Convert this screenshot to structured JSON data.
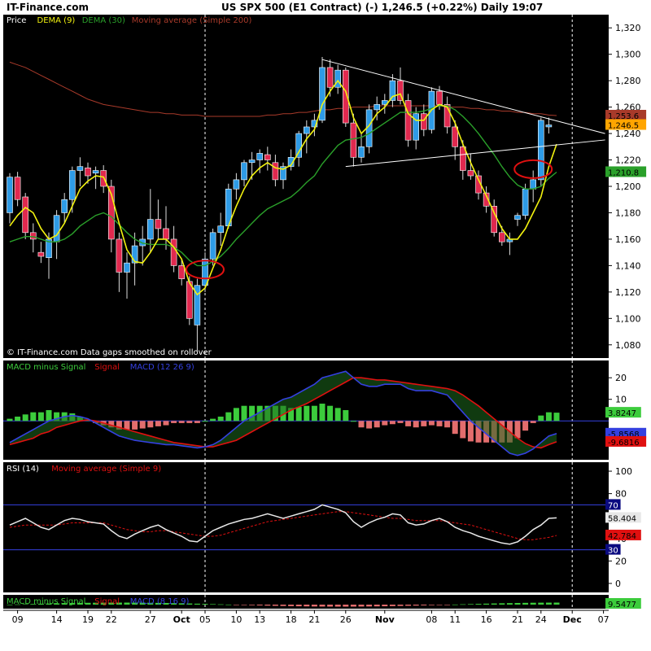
{
  "header": {
    "brand": "IT-Finance.com",
    "title": "US SPX 500 (E1 Contract) (-)    1,246.5 (+0.22%)    Daily  19:07"
  },
  "colors": {
    "background": "#000000",
    "up_candle": "#2e9be6",
    "down_candle": "#e0294f",
    "dema9": "#f2f20f",
    "dema30": "#2aa02a",
    "sma200": "#a83a2a",
    "trendline": "#ffffff",
    "macd": "#3440e0",
    "signal": "#e01010",
    "hist_pos": "#3ccc3c",
    "hist_neg": "#e36d6d",
    "rsi": "#e8e8e8",
    "rsi_ma": "#e01010",
    "ref_line": "#3440e0",
    "circle": "#e01010"
  },
  "chart_data": [
    {
      "type": "candlestick",
      "panel": "price",
      "legend": [
        "Price",
        "DEMA (9)",
        "DEMA (30)",
        "Moving average (Simple 200)"
      ],
      "footnote": "© IT-Finance.com  Data gaps smoothed on rollover",
      "y_ticks": [
        1080,
        1100,
        1120,
        1140,
        1160,
        1180,
        1200,
        1220,
        1240,
        1260,
        1280,
        1300,
        1320
      ],
      "ylim": [
        1070,
        1330
      ],
      "last_price_label": "1,246.5",
      "labels_right": [
        {
          "text": "1,253.6",
          "value": 1253.6,
          "bg": "#a83a2a"
        },
        {
          "text": "1,246.5",
          "value": 1246.5,
          "bg": "#ffa500"
        },
        {
          "text": "1,210.8",
          "value": 1210.8,
          "bg": "#2aa02a"
        }
      ],
      "candles": [
        {
          "o": 1180,
          "h": 1210,
          "l": 1172,
          "c": 1207
        },
        {
          "o": 1207,
          "h": 1211,
          "l": 1185,
          "c": 1190
        },
        {
          "o": 1192,
          "h": 1195,
          "l": 1160,
          "c": 1165
        },
        {
          "o": 1165,
          "h": 1172,
          "l": 1150,
          "c": 1160
        },
        {
          "o": 1150,
          "h": 1158,
          "l": 1142,
          "c": 1147
        },
        {
          "o": 1146,
          "h": 1165,
          "l": 1130,
          "c": 1160
        },
        {
          "o": 1158,
          "h": 1182,
          "l": 1145,
          "c": 1178
        },
        {
          "o": 1180,
          "h": 1195,
          "l": 1172,
          "c": 1190
        },
        {
          "o": 1190,
          "h": 1215,
          "l": 1180,
          "c": 1212
        },
        {
          "o": 1212,
          "h": 1222,
          "l": 1200,
          "c": 1215
        },
        {
          "o": 1214,
          "h": 1218,
          "l": 1202,
          "c": 1208
        },
        {
          "o": 1210,
          "h": 1215,
          "l": 1198,
          "c": 1212
        },
        {
          "o": 1212,
          "h": 1216,
          "l": 1195,
          "c": 1200
        },
        {
          "o": 1200,
          "h": 1205,
          "l": 1150,
          "c": 1160
        },
        {
          "o": 1160,
          "h": 1165,
          "l": 1120,
          "c": 1135
        },
        {
          "o": 1135,
          "h": 1150,
          "l": 1115,
          "c": 1142
        },
        {
          "o": 1142,
          "h": 1165,
          "l": 1125,
          "c": 1155
        },
        {
          "o": 1155,
          "h": 1170,
          "l": 1140,
          "c": 1160
        },
        {
          "o": 1160,
          "h": 1198,
          "l": 1150,
          "c": 1175
        },
        {
          "o": 1175,
          "h": 1190,
          "l": 1160,
          "c": 1168
        },
        {
          "o": 1168,
          "h": 1185,
          "l": 1152,
          "c": 1160
        },
        {
          "o": 1160,
          "h": 1170,
          "l": 1135,
          "c": 1140
        },
        {
          "o": 1140,
          "h": 1145,
          "l": 1125,
          "c": 1130
        },
        {
          "o": 1128,
          "h": 1132,
          "l": 1095,
          "c": 1100
        },
        {
          "o": 1095,
          "h": 1130,
          "l": 1075,
          "c": 1125
        },
        {
          "o": 1125,
          "h": 1150,
          "l": 1120,
          "c": 1145
        },
        {
          "o": 1145,
          "h": 1168,
          "l": 1140,
          "c": 1165
        },
        {
          "o": 1165,
          "h": 1180,
          "l": 1155,
          "c": 1170
        },
        {
          "o": 1170,
          "h": 1202,
          "l": 1168,
          "c": 1198
        },
        {
          "o": 1198,
          "h": 1210,
          "l": 1190,
          "c": 1205
        },
        {
          "o": 1205,
          "h": 1220,
          "l": 1200,
          "c": 1218
        },
        {
          "o": 1218,
          "h": 1226,
          "l": 1205,
          "c": 1220
        },
        {
          "o": 1220,
          "h": 1228,
          "l": 1210,
          "c": 1225
        },
        {
          "o": 1224,
          "h": 1230,
          "l": 1212,
          "c": 1220
        },
        {
          "o": 1218,
          "h": 1224,
          "l": 1200,
          "c": 1205
        },
        {
          "o": 1205,
          "h": 1218,
          "l": 1198,
          "c": 1215
        },
        {
          "o": 1215,
          "h": 1228,
          "l": 1212,
          "c": 1222
        },
        {
          "o": 1222,
          "h": 1242,
          "l": 1215,
          "c": 1240
        },
        {
          "o": 1240,
          "h": 1250,
          "l": 1225,
          "c": 1245
        },
        {
          "o": 1245,
          "h": 1255,
          "l": 1238,
          "c": 1250
        },
        {
          "o": 1250,
          "h": 1298,
          "l": 1248,
          "c": 1290
        },
        {
          "o": 1290,
          "h": 1296,
          "l": 1268,
          "c": 1275
        },
        {
          "o": 1275,
          "h": 1292,
          "l": 1270,
          "c": 1288
        },
        {
          "o": 1288,
          "h": 1290,
          "l": 1245,
          "c": 1248
        },
        {
          "o": 1248,
          "h": 1255,
          "l": 1215,
          "c": 1222
        },
        {
          "o": 1222,
          "h": 1240,
          "l": 1218,
          "c": 1230
        },
        {
          "o": 1230,
          "h": 1262,
          "l": 1225,
          "c": 1258
        },
        {
          "o": 1258,
          "h": 1268,
          "l": 1250,
          "c": 1262
        },
        {
          "o": 1262,
          "h": 1270,
          "l": 1255,
          "c": 1265
        },
        {
          "o": 1265,
          "h": 1285,
          "l": 1260,
          "c": 1280
        },
        {
          "o": 1280,
          "h": 1290,
          "l": 1262,
          "c": 1265
        },
        {
          "o": 1265,
          "h": 1270,
          "l": 1230,
          "c": 1235
        },
        {
          "o": 1235,
          "h": 1260,
          "l": 1228,
          "c": 1255
        },
        {
          "o": 1255,
          "h": 1262,
          "l": 1238,
          "c": 1243
        },
        {
          "o": 1243,
          "h": 1275,
          "l": 1240,
          "c": 1272
        },
        {
          "o": 1272,
          "h": 1276,
          "l": 1258,
          "c": 1262
        },
        {
          "o": 1262,
          "h": 1268,
          "l": 1240,
          "c": 1245
        },
        {
          "o": 1245,
          "h": 1250,
          "l": 1220,
          "c": 1230
        },
        {
          "o": 1230,
          "h": 1235,
          "l": 1205,
          "c": 1212
        },
        {
          "o": 1212,
          "h": 1225,
          "l": 1205,
          "c": 1208
        },
        {
          "o": 1208,
          "h": 1212,
          "l": 1190,
          "c": 1195
        },
        {
          "o": 1195,
          "h": 1200,
          "l": 1180,
          "c": 1185
        },
        {
          "o": 1185,
          "h": 1190,
          "l": 1162,
          "c": 1165
        },
        {
          "o": 1165,
          "h": 1170,
          "l": 1155,
          "c": 1158
        },
        {
          "o": 1158,
          "h": 1165,
          "l": 1148,
          "c": 1160
        },
        {
          "o": 1175,
          "h": 1180,
          "l": 1170,
          "c": 1178
        },
        {
          "o": 1178,
          "h": 1202,
          "l": 1175,
          "c": 1198
        },
        {
          "o": 1198,
          "h": 1212,
          "l": 1188,
          "c": 1205
        },
        {
          "o": 1205,
          "h": 1252,
          "l": 1200,
          "c": 1250
        },
        {
          "o": 1245,
          "h": 1252,
          "l": 1240,
          "c": 1246.5
        }
      ],
      "dema9": [
        1170,
        1178,
        1184,
        1180,
        1168,
        1160,
        1163,
        1172,
        1185,
        1198,
        1204,
        1208,
        1207,
        1194,
        1172,
        1152,
        1143,
        1142,
        1150,
        1160,
        1160,
        1154,
        1145,
        1127,
        1118,
        1123,
        1138,
        1152,
        1170,
        1185,
        1198,
        1208,
        1214,
        1218,
        1214,
        1213,
        1216,
        1226,
        1236,
        1243,
        1262,
        1272,
        1280,
        1272,
        1252,
        1240,
        1246,
        1255,
        1260,
        1268,
        1270,
        1255,
        1250,
        1250,
        1258,
        1262,
        1260,
        1248,
        1232,
        1218,
        1205,
        1193,
        1180,
        1168,
        1160,
        1160,
        1168,
        1180,
        1192,
        1215,
        1232
      ],
      "dema30": [
        1158,
        1160,
        1162,
        1162,
        1160,
        1158,
        1158,
        1160,
        1164,
        1170,
        1174,
        1178,
        1180,
        1177,
        1171,
        1165,
        1160,
        1157,
        1156,
        1156,
        1156,
        1154,
        1150,
        1144,
        1140,
        1140,
        1143,
        1147,
        1153,
        1160,
        1166,
        1172,
        1178,
        1183,
        1186,
        1189,
        1192,
        1197,
        1203,
        1208,
        1217,
        1224,
        1231,
        1235,
        1236,
        1237,
        1240,
        1244,
        1248,
        1252,
        1256,
        1256,
        1256,
        1257,
        1259,
        1261,
        1261,
        1258,
        1253,
        1247,
        1240,
        1232,
        1224,
        1215,
        1207,
        1201,
        1198,
        1198,
        1200,
        1206,
        1210.8
      ],
      "sma200": [
        1294,
        1292,
        1290,
        1287,
        1284,
        1281,
        1278,
        1275,
        1272,
        1269,
        1266,
        1264,
        1262,
        1261,
        1260,
        1259,
        1258,
        1257,
        1256,
        1256,
        1255,
        1255,
        1254,
        1254,
        1254,
        1253,
        1253,
        1253,
        1253,
        1253,
        1253,
        1253,
        1253,
        1254,
        1254,
        1255,
        1255,
        1256,
        1256,
        1257,
        1258,
        1258,
        1259,
        1259,
        1260,
        1260,
        1260,
        1261,
        1261,
        1261,
        1261,
        1261,
        1261,
        1261,
        1261,
        1261,
        1260,
        1260,
        1260,
        1259,
        1259,
        1258,
        1258,
        1257,
        1257,
        1256,
        1256,
        1255,
        1255,
        1254,
        1253.6
      ],
      "trend_upper": [
        {
          "i": 40,
          "v": 1296
        },
        {
          "i": 71,
          "v": 1248
        }
      ],
      "trend_lower": [
        {
          "i": 43,
          "v": 1215
        },
        {
          "i": 71,
          "v": 1232
        }
      ],
      "circles": [
        {
          "i": 25,
          "v": 1137
        },
        {
          "i": 67,
          "v": 1213
        }
      ]
    },
    {
      "type": "histogram+line",
      "panel": "macd",
      "legend": [
        "MACD minus Signal",
        "Signal",
        "MACD (12 26 9)"
      ],
      "y_ticks": [
        10,
        20
      ],
      "ylim": [
        -18,
        28
      ],
      "labels_right": [
        {
          "text": "3.8247",
          "value": 3.8247,
          "bg": "#3ccc3c"
        },
        {
          "text": "-5.8568",
          "value": -5.8568,
          "bg": "#3440e0"
        },
        {
          "text": "-9.6816",
          "value": -9.6816,
          "bg": "#e01010"
        }
      ],
      "macd": [
        -10,
        -8,
        -6,
        -4,
        -2,
        0,
        1,
        2,
        2.5,
        2,
        1,
        -1,
        -3,
        -5,
        -7,
        -8,
        -9,
        -9.5,
        -10,
        -10.5,
        -11,
        -11,
        -11.5,
        -12,
        -12.5,
        -12,
        -11,
        -9,
        -6,
        -3,
        0,
        2,
        4,
        6,
        8,
        10,
        11,
        13,
        15,
        17,
        20,
        21,
        22,
        23,
        20,
        17,
        16,
        16,
        17,
        17,
        17,
        15,
        14,
        14,
        14,
        13,
        12,
        8,
        4,
        0,
        -3,
        -6,
        -9,
        -12,
        -15,
        -16,
        -15,
        -13,
        -10,
        -7,
        -5.8568
      ],
      "signal": [
        -11,
        -10,
        -9,
        -8,
        -6,
        -5,
        -3,
        -2,
        -1,
        0,
        0.5,
        0,
        -1,
        -2,
        -3,
        -4,
        -5,
        -6,
        -7,
        -8,
        -9,
        -10,
        -10.5,
        -11,
        -11.5,
        -12,
        -12,
        -11,
        -10,
        -9,
        -7,
        -5,
        -3,
        -1,
        1,
        3,
        5,
        6.5,
        8,
        10,
        12,
        14,
        16,
        18,
        20,
        20,
        19.5,
        19,
        19,
        18.5,
        18,
        17.5,
        17,
        16.5,
        16,
        15.5,
        15,
        14,
        12,
        9.5,
        7,
        4,
        1,
        -2,
        -5,
        -8,
        -10.5,
        -12,
        -12.5,
        -11,
        -9.6816
      ],
      "histogram": [
        1,
        2,
        3,
        4,
        4,
        5,
        4,
        4,
        3.5,
        2,
        0.5,
        -1,
        -2,
        -3,
        -4,
        -4,
        -4,
        -3.5,
        -3,
        -2.5,
        -2,
        -1,
        -1,
        -1,
        -1,
        0,
        1,
        2,
        4,
        6,
        7,
        7,
        7,
        7,
        7,
        7,
        6,
        6.5,
        7,
        7,
        8,
        7,
        6,
        5,
        0,
        -3,
        -3.5,
        -3,
        -2,
        -1.5,
        -1,
        -2.5,
        -3,
        -2.5,
        -2,
        -2.5,
        -3,
        -6,
        -8,
        -9.5,
        -10,
        -10,
        -10,
        -10,
        -10,
        -8,
        -4.5,
        -1,
        2.5,
        4,
        3.8247
      ]
    },
    {
      "type": "line",
      "panel": "rsi",
      "legend": [
        "RSI (14)",
        "Moving average (Simple 9)"
      ],
      "y_ticks": [
        0,
        20,
        40,
        60,
        80,
        100
      ],
      "ylim": [
        -8,
        108
      ],
      "ref_lines": [
        {
          "value": 70,
          "label": "70"
        },
        {
          "value": 30,
          "label": "30"
        }
      ],
      "labels_right": [
        {
          "text": "58.404",
          "value": 58.404,
          "bg": "#e8e8e8"
        },
        {
          "text": "42.784",
          "value": 42.784,
          "bg": "#e01010"
        }
      ],
      "rsi": [
        52,
        55,
        58,
        54,
        50,
        48,
        52,
        56,
        58,
        57,
        55,
        54,
        53,
        47,
        42,
        40,
        44,
        47,
        50,
        52,
        48,
        45,
        42,
        38,
        37,
        42,
        47,
        50,
        53,
        55,
        57,
        58,
        60,
        62,
        60,
        58,
        60,
        62,
        64,
        66,
        70,
        68,
        66,
        63,
        55,
        50,
        54,
        57,
        59,
        62,
        61,
        54,
        52,
        53,
        56,
        58,
        55,
        50,
        47,
        45,
        42,
        40,
        38,
        36,
        35,
        37,
        42,
        48,
        52,
        58,
        58.404
      ],
      "rsi_ma": [
        50,
        51,
        52,
        52,
        52,
        52,
        52,
        53,
        54,
        54,
        54,
        54,
        54,
        52,
        50,
        48,
        47,
        46,
        46,
        47,
        47,
        46,
        45,
        44,
        43,
        42,
        42,
        43,
        45,
        47,
        49,
        51,
        53,
        55,
        56,
        57,
        58,
        59,
        60,
        61,
        62,
        63,
        64,
        64,
        63,
        62,
        61,
        60,
        59,
        58,
        58,
        57,
        56,
        56,
        56,
        56,
        55,
        54,
        53,
        52,
        50,
        48,
        46,
        44,
        42,
        40,
        39,
        39,
        40,
        41,
        42.784
      ]
    },
    {
      "type": "histogram+line",
      "panel": "macd2",
      "legend": [
        "MACD minus Signal",
        "Signal",
        "MACD (8 16 9)"
      ],
      "labels_right": [
        {
          "text": "9.5477",
          "value": 9.5477,
          "bg": "#3ccc3c"
        }
      ]
    }
  ],
  "x_axis": {
    "ticks": [
      {
        "i": 1,
        "label": "09"
      },
      {
        "i": 6,
        "label": "14"
      },
      {
        "i": 10,
        "label": "19"
      },
      {
        "i": 13,
        "label": "22"
      },
      {
        "i": 18,
        "label": "27"
      },
      {
        "i": 22,
        "label": "Oct"
      },
      {
        "i": 25,
        "label": "05"
      },
      {
        "i": 29,
        "label": "10"
      },
      {
        "i": 32,
        "label": "13"
      },
      {
        "i": 36,
        "label": "18"
      },
      {
        "i": 39,
        "label": "21"
      },
      {
        "i": 43,
        "label": "26"
      },
      {
        "i": 48,
        "label": "Nov"
      },
      {
        "i": 54,
        "label": "08"
      },
      {
        "i": 57,
        "label": "11"
      },
      {
        "i": 61,
        "label": "16"
      },
      {
        "i": 65,
        "label": "21"
      },
      {
        "i": 68,
        "label": "24"
      },
      {
        "i": 72,
        "label": "Dec"
      },
      {
        "i": 76,
        "label": "07"
      }
    ],
    "vlines": [
      25,
      72
    ]
  }
}
